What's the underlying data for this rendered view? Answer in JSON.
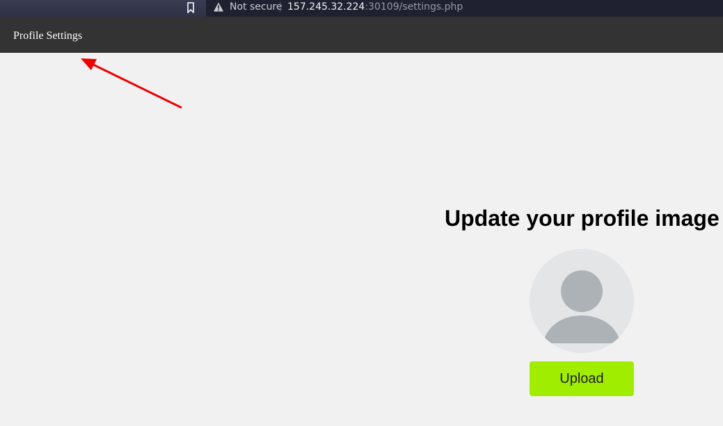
{
  "browser": {
    "security_label": "Not secure",
    "url_host": "157.245.32.224",
    "url_rest": ":30109/settings.php"
  },
  "navbar": {
    "title": "Profile Settings"
  },
  "main": {
    "heading": "Update your profile image",
    "upload_label": "Upload"
  },
  "icons": {
    "bookmark": "bookmark-icon",
    "warning": "warning-icon",
    "avatar": "default-user-avatar-icon"
  },
  "colors": {
    "navbar_bg": "#333333",
    "page_bg": "#f1f1f1",
    "upload_button": "#a1ed00",
    "annotation_arrow": "#ee0000"
  }
}
